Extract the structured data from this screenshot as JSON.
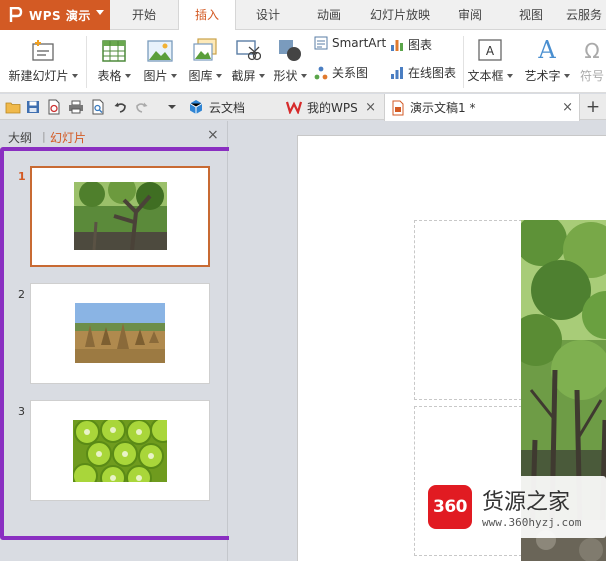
{
  "app": {
    "name": "WPS 演示"
  },
  "menu": {
    "tabs": [
      {
        "label": "开始"
      },
      {
        "label": "插入"
      },
      {
        "label": "设计"
      },
      {
        "label": "动画"
      },
      {
        "label": "幻灯片放映"
      },
      {
        "label": "审阅"
      },
      {
        "label": "视图"
      },
      {
        "label": "云服务"
      }
    ],
    "active_tab": "插入"
  },
  "ribbon": {
    "new_slide": "新建幻灯片",
    "table": "表格",
    "picture": "图片",
    "gallery": "图库",
    "screenshot": "截屏",
    "shape": "形状",
    "smartart": "SmartArt",
    "chart": "图表",
    "relation": "关系图",
    "online_chart": "在线图表",
    "textbox": "文本框",
    "wordart": "艺术字",
    "symbol": "符号"
  },
  "doc_tabs": [
    {
      "label": "云文档"
    },
    {
      "label": "我的WPS"
    },
    {
      "label": "演示文稿1 *"
    }
  ],
  "pane": {
    "outline_label": "大纲",
    "divider": "|",
    "slides_label": "幻灯片",
    "slides": [
      {
        "number": "1",
        "image": "forest-photo"
      },
      {
        "number": "2",
        "image": "field-photo"
      },
      {
        "number": "3",
        "image": "kiwi-photo"
      }
    ]
  },
  "watermark": {
    "badge": "360",
    "title": "货源之家",
    "url": "www.360hyzj.com"
  },
  "colors": {
    "accent": "#d35a24",
    "highlight": "#8a2fc1",
    "watermark_red": "#e11b22"
  }
}
